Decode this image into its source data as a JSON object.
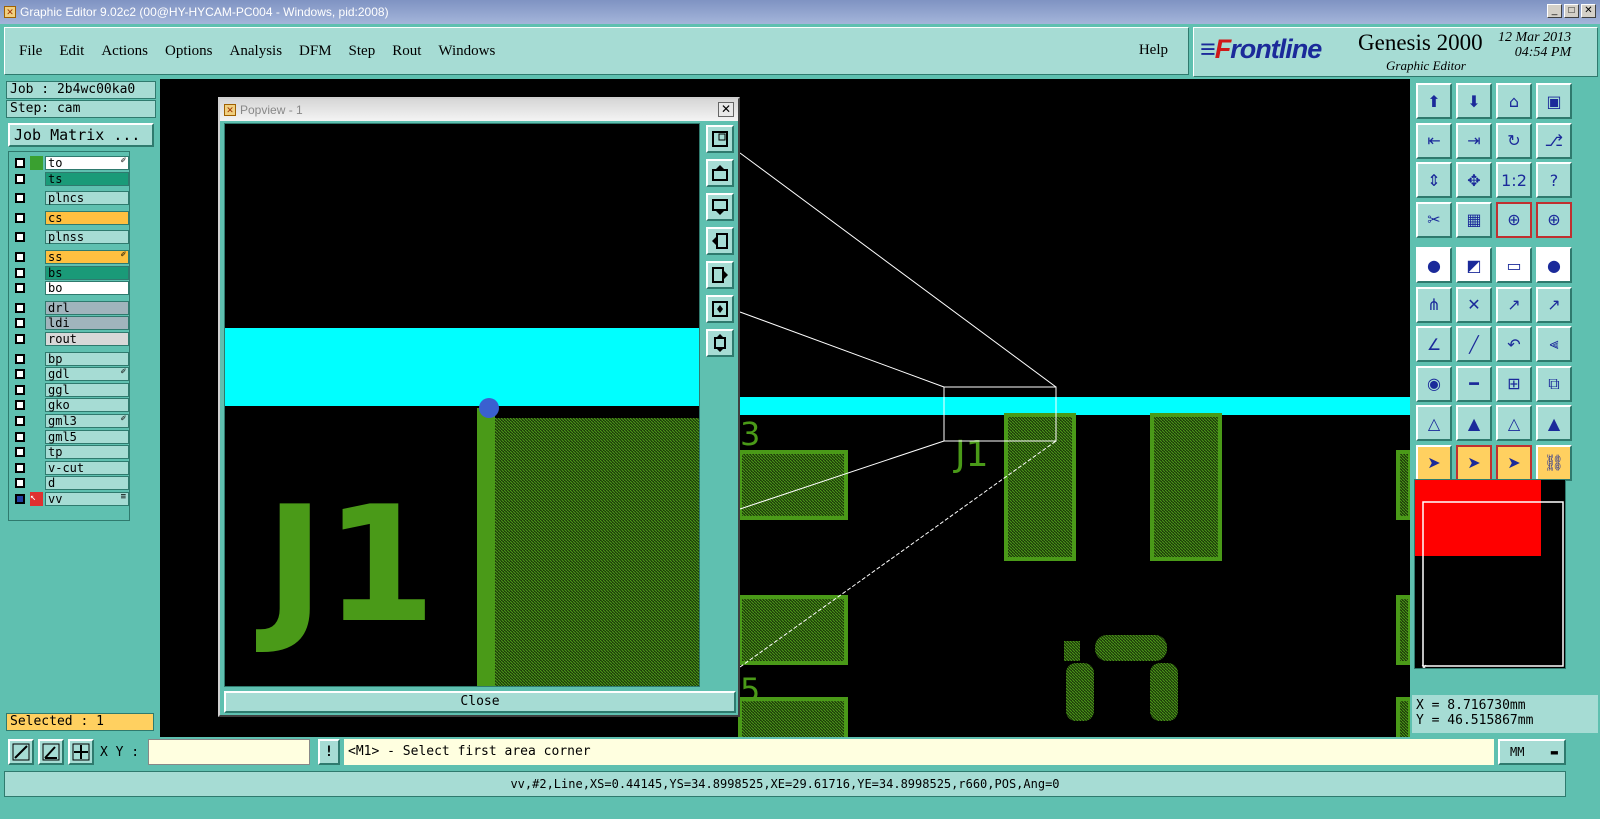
{
  "window": {
    "title": "Graphic Editor 9.02c2 (00@HY-HYCAM-PC004 - Windows, pid:2008)"
  },
  "menu": {
    "items": [
      "File",
      "Edit",
      "Actions",
      "Options",
      "Analysis",
      "DFM",
      "Step",
      "Rout",
      "Windows"
    ],
    "help": "Help"
  },
  "brand": {
    "logo_a": "F",
    "logo_b": "rontline",
    "title": "Genesis 2000",
    "subtitle": "Graphic Editor",
    "date": "12 Mar 2013",
    "time": "04:54 PM"
  },
  "job": {
    "job_label": "Job : 2b4wc00ka0",
    "step_label": "Step: cam",
    "matrix_button": "Job Matrix ..."
  },
  "layers": [
    {
      "name": "to",
      "color": "#ffffff",
      "swatch": "#3aa030",
      "mark": "✐"
    },
    {
      "name": "ts",
      "color": "#1a9a78",
      "swatch": "#a6dcd4",
      "mark": ""
    },
    {
      "name": "plncs",
      "color": "#a6dcd4",
      "swatch": "#a6dcd4",
      "mark": ""
    },
    {
      "name": "cs",
      "color": "#ffc040",
      "swatch": "#a6dcd4",
      "mark": ""
    },
    {
      "name": "plnss",
      "color": "#a6dcd4",
      "swatch": "#a6dcd4",
      "mark": ""
    },
    {
      "name": "ss",
      "color": "#ffc040",
      "swatch": "#a6dcd4",
      "mark": "✐"
    },
    {
      "name": "bs",
      "color": "#1a9a78",
      "swatch": "#a6dcd4",
      "mark": ""
    },
    {
      "name": "bo",
      "color": "#ffffff",
      "swatch": "#a6dcd4",
      "mark": ""
    },
    {
      "name": "drl",
      "color": "#a0b4bc",
      "swatch": "#a6dcd4",
      "mark": ""
    },
    {
      "name": "ldi",
      "color": "#a0b4bc",
      "swatch": "#a6dcd4",
      "mark": ""
    },
    {
      "name": "rout",
      "color": "#d8d8d8",
      "swatch": "#a6dcd4",
      "mark": ""
    },
    {
      "name": "bp",
      "color": "#a6dcd4",
      "swatch": "#a6dcd4",
      "mark": ""
    },
    {
      "name": "gdl",
      "color": "#a6dcd4",
      "swatch": "#a6dcd4",
      "mark": "✐"
    },
    {
      "name": "ggl",
      "color": "#a6dcd4",
      "swatch": "#a6dcd4",
      "mark": ""
    },
    {
      "name": "gko",
      "color": "#a6dcd4",
      "swatch": "#a6dcd4",
      "mark": ""
    },
    {
      "name": "gml3",
      "color": "#a6dcd4",
      "swatch": "#a6dcd4",
      "mark": "✐"
    },
    {
      "name": "gml5",
      "color": "#a6dcd4",
      "swatch": "#a6dcd4",
      "mark": ""
    },
    {
      "name": "tp",
      "color": "#a6dcd4",
      "swatch": "#a6dcd4",
      "mark": ""
    },
    {
      "name": "v-cut",
      "color": "#a6dcd4",
      "swatch": "#a6dcd4",
      "mark": ""
    },
    {
      "name": "d",
      "color": "#a6dcd4",
      "swatch": "#a6dcd4",
      "mark": ""
    },
    {
      "name": "vv",
      "color": "#a6dcd4",
      "swatch": "#e03030",
      "mark": "≡"
    }
  ],
  "selected": "Selected : 1",
  "popview": {
    "title": "Popview - 1",
    "close_x": "✕",
    "close_button": "Close",
    "ref_text": "J1"
  },
  "canvas": {
    "ref_text": "J1",
    "ref_text_left": "3",
    "ref_text_left2": "5"
  },
  "coords": {
    "x": "X = 8.716730mm",
    "y": "Y = 46.515867mm"
  },
  "command": {
    "xy_label": "X Y :",
    "xy_value": "",
    "excl": "!",
    "prompt": "<M1> - Select first area corner",
    "units": "MM"
  },
  "status": "vv,#2,Line,XS=0.44145,YS=34.8998525,XE=29.61716,YE=34.8998525,r660,POS,Ang=0",
  "colors": {
    "canvas_bg": "#000000",
    "cyan_trace": "#00ffff",
    "pad_green": "#4a9a18",
    "panel": "#a6dcd4",
    "frame": "#5fc0b0"
  },
  "toolbar_icons": [
    "zoom-home-icon",
    "zoom-down-icon",
    "home-icon",
    "panel-icon",
    "pan-left-icon",
    "pan-right-icon",
    "redraw-icon",
    "snap-icon",
    "fit-vertical-icon",
    "fit-both-icon",
    "scale-1-2-icon",
    "help-icon",
    "measure-icon",
    "grid-icon",
    "net-highlight-icon",
    "net-highlight2-icon",
    "pad-icon",
    "line-draw-icon",
    "ruler-icon",
    "circle-icon",
    "connect-icon",
    "delete-icon",
    "move-icon",
    "move2-icon",
    "angle-icon",
    "slash-icon",
    "undo-icon",
    "mirror-icon",
    "add-pad-icon",
    "line-red-icon",
    "resize-icon",
    "copy-icon",
    "triangle-icon",
    "triangle2-icon",
    "triangle3-icon",
    "triangle4-icon",
    "select-icon",
    "select2-icon",
    "select3-icon",
    "net-select-icon"
  ]
}
